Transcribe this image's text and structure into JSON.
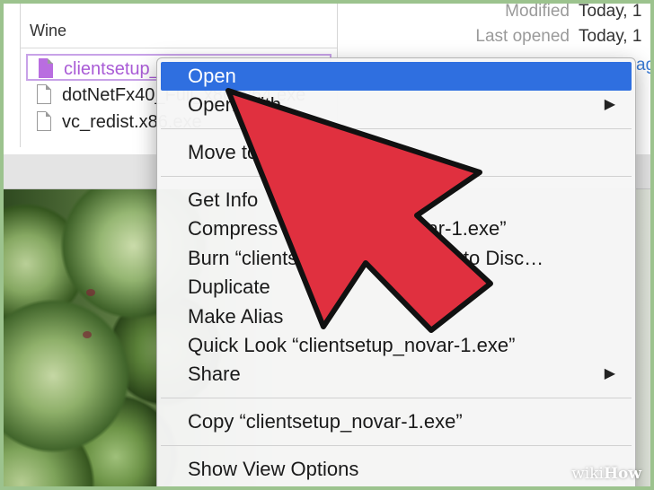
{
  "finder": {
    "folder_name": "Wine",
    "files": [
      {
        "name": "clientsetup_novar-1.exe",
        "selected": true
      },
      {
        "name": "dotNetFx40_Full_x86_x64.exe",
        "selected": false
      },
      {
        "name": "vc_redist.x86.exe",
        "selected": false
      }
    ],
    "info": {
      "modified_label": "Modified",
      "modified_value": "Today, 1",
      "last_opened_label": "Last opened",
      "last_opened_value": "Today, 1",
      "tags_link": "ag"
    }
  },
  "context_menu": {
    "items": [
      {
        "label": "Open",
        "highlighted": true
      },
      {
        "label": "Open With",
        "submenu": true
      },
      {
        "label": "Move to Trash"
      },
      {
        "label": "Get Info"
      },
      {
        "label": "Compress “clientsetup_novar-1.exe”"
      },
      {
        "label": "Burn “clientsetup_novar-1.exe” to Disc…"
      },
      {
        "label": "Duplicate"
      },
      {
        "label": "Make Alias"
      },
      {
        "label": "Quick Look “clientsetup_novar-1.exe”"
      },
      {
        "label": "Share",
        "submenu": true
      },
      {
        "label": "Copy “clientsetup_novar-1.exe”"
      },
      {
        "label": "Show View Options"
      }
    ],
    "submenu_arrow": "▶"
  },
  "annotation": {
    "arrow_color": "#e0303f",
    "arrow_outline": "#111111"
  },
  "watermark": {
    "prefix": "wiki",
    "suffix": "How"
  }
}
